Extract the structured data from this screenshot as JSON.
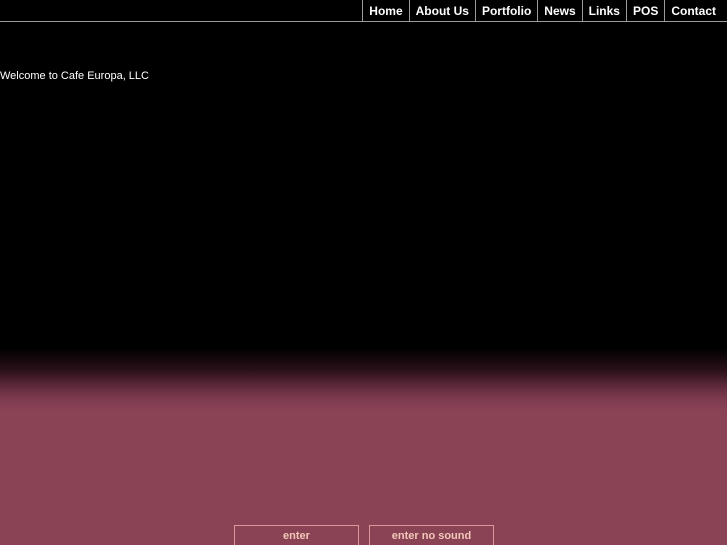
{
  "nav": {
    "items": [
      {
        "label": "Home"
      },
      {
        "label": "About Us"
      },
      {
        "label": "Portfolio"
      },
      {
        "label": "News"
      },
      {
        "label": "Links"
      },
      {
        "label": "POS"
      },
      {
        "label": "Contact"
      }
    ]
  },
  "main": {
    "welcome": "Welcome to Cafe Europa, LLC"
  },
  "actions": {
    "enter_label": "enter",
    "enter_no_sound_label": "enter no sound"
  },
  "colors": {
    "background_top": "#000000",
    "background_bottom": "#8a4255",
    "button_border": "#d89a9a",
    "button_text": "#f2c8b8"
  }
}
